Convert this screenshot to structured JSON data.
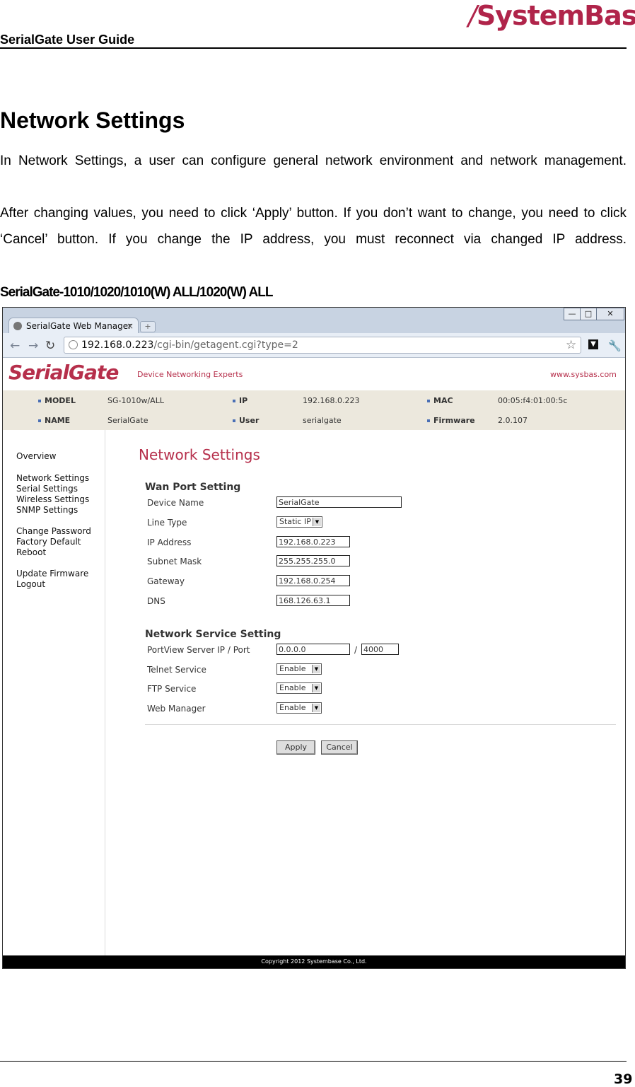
{
  "header": {
    "doc_title": "SerialGate User Guide",
    "logo": "SystemBase",
    "logo_color": "#b0244a"
  },
  "section": {
    "title": "Network Settings",
    "paragraph1": "In Network Settings, a user can configure general network environment and network management.",
    "paragraph2": "After changing values, you need to click ‘Apply’ button. If you don’t want to change, you need to click ‘Cancel’ button. If you change the IP address, you must reconnect via changed IP address.",
    "subtitle": "SerialGate-1010/1020/1010(W) ALL/1020(W) ALL"
  },
  "browser": {
    "tab_label": "SerialGate Web Manager",
    "tab_close": "×",
    "url_host": "192.168.0.223",
    "url_path": "/cgi-bin/getagent.cgi?type=2",
    "window_buttons": [
      "—",
      "□",
      "✕"
    ],
    "icons": {
      "back": "back-arrow-icon",
      "forward": "forward-arrow-icon",
      "reload": "reload-icon",
      "star": "bookmark-star-icon",
      "wrench": "wrench-icon"
    }
  },
  "site": {
    "brand": "SerialGate",
    "tagline": "Device Networking Experts",
    "url": "www.sysbas.com",
    "accent": "#b62f4b",
    "info": {
      "model_label": "MODEL",
      "model": "SG-1010w/ALL",
      "ip_label": "IP",
      "ip": "192.168.0.223",
      "mac_label": "MAC",
      "mac": "00:05:f4:01:00:5c",
      "name_label": "NAME",
      "name": "SerialGate",
      "user_label": "User",
      "user": "serialgate",
      "firmware_label": "Firmware",
      "firmware": "2.0.107"
    },
    "menu": [
      "Overview",
      "Network Settings",
      "Serial Settings",
      "Wireless Settings",
      "SNMP Settings",
      "Change Password",
      "Factory Default",
      "Reboot",
      "Update Firmware",
      "Logout"
    ],
    "content_title": "Network Settings",
    "wan": {
      "title": "Wan Port Setting",
      "device_name_label": "Device Name",
      "device_name": "SerialGate",
      "line_type_label": "Line Type",
      "line_type": "Static IP",
      "ip_label": "IP Address",
      "ip": "192.168.0.223",
      "subnet_label": "Subnet Mask",
      "subnet": "255.255.255.0",
      "gateway_label": "Gateway",
      "gateway": "192.168.0.254",
      "dns_label": "DNS",
      "dns": "168.126.63.1"
    },
    "service": {
      "title": "Network Service Setting",
      "portview_label": "PortView Server IP / Port",
      "portview_ip": "0.0.0.0",
      "separator": "/",
      "portview_port": "4000",
      "telnet_label": "Telnet Service",
      "telnet": "Enable",
      "ftp_label": "FTP Service",
      "ftp": "Enable",
      "web_label": "Web Manager",
      "web": "Enable"
    },
    "apply_label": "Apply",
    "cancel_label": "Cancel",
    "footer": "Copyright 2012 Systembase Co., Ltd."
  },
  "page_number": "39"
}
